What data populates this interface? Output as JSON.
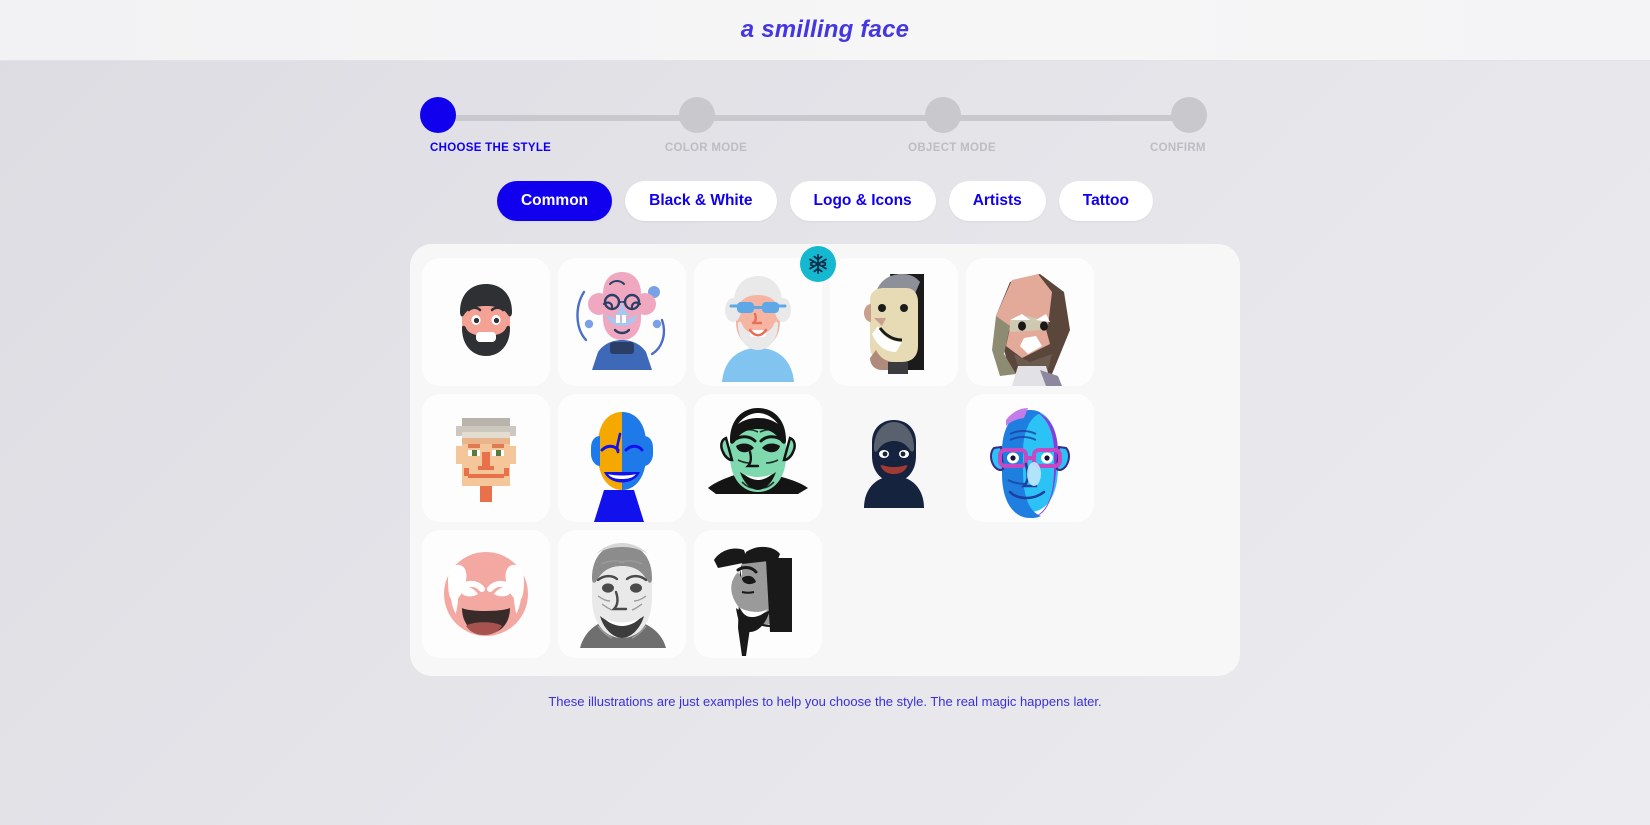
{
  "header": {
    "title": "a smilling face"
  },
  "stepper": {
    "steps": [
      {
        "label": "CHOOSE THE STYLE",
        "state": "active"
      },
      {
        "label": "COLOR MODE",
        "state": "inactive"
      },
      {
        "label": "OBJECT MODE",
        "state": "inactive"
      },
      {
        "label": "CONFIRM",
        "state": "inactive"
      }
    ],
    "active_color": "#1100ee",
    "inactive_color": "#c9c9cd"
  },
  "tabs": {
    "items": [
      {
        "label": "Common",
        "selected": true
      },
      {
        "label": "Black & White",
        "selected": false
      },
      {
        "label": "Logo & Icons",
        "selected": false
      },
      {
        "label": "Artists",
        "selected": false
      },
      {
        "label": "Tattoo",
        "selected": false
      }
    ],
    "selected_bg": "#1100ee",
    "unselected_bg": "#ffffff",
    "unselected_text": "#1100ee"
  },
  "gallery": {
    "items": [
      {
        "name": "bearded-man-flat-avatar",
        "badge": null
      },
      {
        "name": "bald-man-blue-moustache-cartoon",
        "badge": null
      },
      {
        "name": "grandpa-blue-glasses-avatar",
        "badge": "snowflake-icon"
      },
      {
        "name": "cubist-profile-face",
        "badge": null
      },
      {
        "name": "low-poly-bearded-man",
        "badge": null
      },
      {
        "name": "pixel-art-face",
        "badge": null
      },
      {
        "name": "yellow-blue-laughing-face",
        "badge": null
      },
      {
        "name": "green-old-man-line-art",
        "badge": null
      },
      {
        "name": "navy-hooded-man-icon",
        "badge": null
      },
      {
        "name": "neon-blue-glitch-portrait",
        "badge": null
      },
      {
        "name": "pink-laughing-grandpa",
        "badge": null
      },
      {
        "name": "grayscale-engraved-smiling-man",
        "badge": null
      },
      {
        "name": "grayscale-stencil-hat-man",
        "badge": null
      }
    ]
  },
  "footnote": {
    "text": "These illustrations are just examples to help you choose the style. The real magic happens later."
  }
}
